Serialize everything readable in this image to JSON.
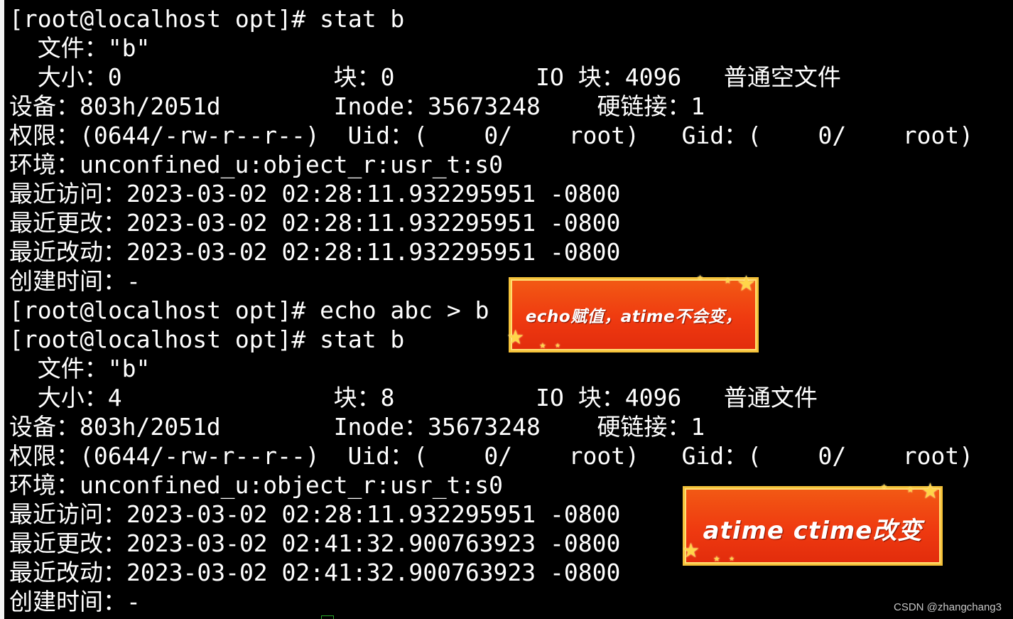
{
  "terminal": {
    "lines": [
      "[root@localhost opt]# stat b",
      "  文件：\"b\"",
      "  大小：0               块：0          IO 块：4096   普通空文件",
      "设备：803h/2051d        Inode：35673248    硬链接：1",
      "权限：(0644/-rw-r--r--)  Uid：(    0/    root)   Gid：(    0/    root)",
      "环境：unconfined_u:object_r:usr_t:s0",
      "最近访问：2023-03-02 02:28:11.932295951 -0800",
      "最近更改：2023-03-02 02:28:11.932295951 -0800",
      "最近改动：2023-03-02 02:28:11.932295951 -0800",
      "创建时间：-",
      "[root@localhost opt]# echo abc > b",
      "[root@localhost opt]# stat b",
      "  文件：\"b\"",
      "  大小：4               块：8          IO 块：4096   普通文件",
      "设备：803h/2051d        Inode：35673248    硬链接：1",
      "权限：(0644/-rw-r--r--)  Uid：(    0/    root)   Gid：(    0/    root)",
      "环境：unconfined_u:object_r:usr_t:s0",
      "最近访问：2023-03-02 02:28:11.932295951 -0800",
      "最近更改：2023-03-02 02:41:32.900763923 -0800",
      "最近改动：2023-03-02 02:41:32.900763923 -0800",
      "创建时间：-"
    ]
  },
  "annotations": {
    "badge1": "echo赋值，atime不会变，",
    "badge2": "atime  ctime改变"
  },
  "watermark": "CSDN @zhangchang3",
  "colors": {
    "background": "#000000",
    "text": "#ffffff",
    "badge_fill": "#ef3a10",
    "badge_border": "#f5c23a"
  }
}
